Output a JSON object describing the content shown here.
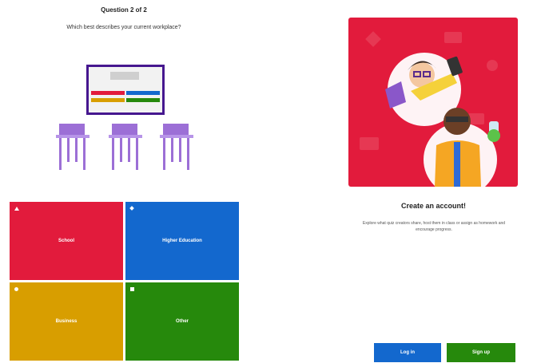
{
  "quiz": {
    "progress": "Question 2 of 2",
    "question": "Which best describes your current workplace?",
    "answers": [
      {
        "label": "School",
        "color": "#e21b3c",
        "shape": "triangle"
      },
      {
        "label": "Higher Education",
        "color": "#1368ce",
        "shape": "diamond"
      },
      {
        "label": "Business",
        "color": "#d89e00",
        "shape": "circle"
      },
      {
        "label": "Other",
        "color": "#26890c",
        "shape": "square"
      }
    ]
  },
  "signup_panel": {
    "title": "Create an account!",
    "description": "Explore what quiz creators share, host them in class or assign as homework and encourage progress.",
    "login_label": "Log in",
    "signup_label": "Sign up"
  }
}
